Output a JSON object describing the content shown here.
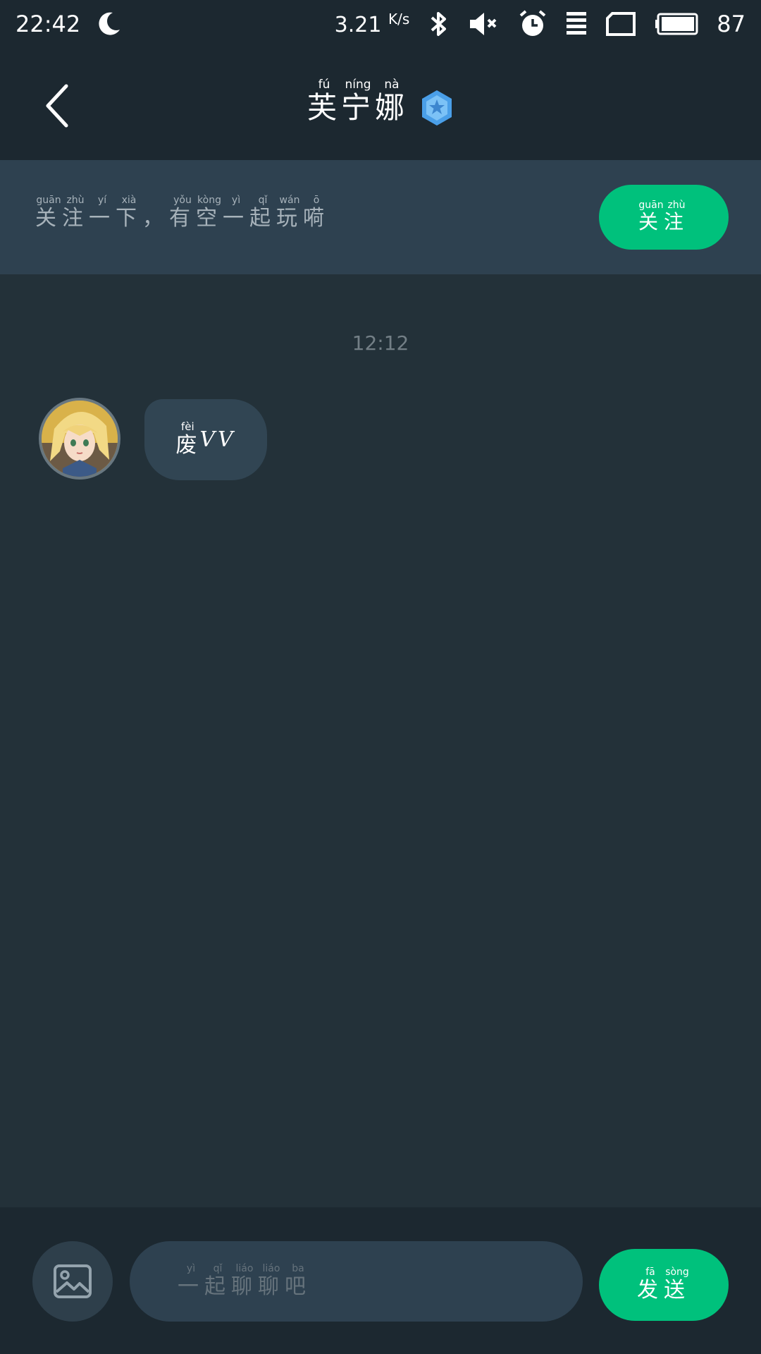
{
  "status_bar": {
    "time": "22:42",
    "net_speed": "3.21",
    "net_unit": "K/s",
    "battery": "87",
    "icons": [
      "moon-icon",
      "bluetooth-icon",
      "mute-icon",
      "alarm-icon",
      "signal-icon",
      "sim-icon",
      "battery-icon"
    ]
  },
  "header": {
    "back_icon": "chevron-left-icon",
    "title_chars": [
      {
        "c": "芙",
        "py": "fú"
      },
      {
        "c": "宁",
        "py": "níng"
      },
      {
        "c": "娜",
        "py": "nà"
      }
    ],
    "badge_icon": "verified-badge-icon"
  },
  "follow_banner": {
    "chars": [
      {
        "c": "关",
        "py": "guān"
      },
      {
        "c": "注",
        "py": "zhù"
      },
      {
        "c": "一",
        "py": "yí"
      },
      {
        "c": "下",
        "py": "xià"
      },
      {
        "c": "，",
        "py": ""
      },
      {
        "c": "有",
        "py": "yǒu"
      },
      {
        "c": "空",
        "py": "kòng"
      },
      {
        "c": "一",
        "py": "yì"
      },
      {
        "c": "起",
        "py": "qǐ"
      },
      {
        "c": "玩",
        "py": "wán"
      },
      {
        "c": "嗬",
        "py": "ō"
      }
    ],
    "button_chars": [
      {
        "c": "关",
        "py": "guān"
      },
      {
        "c": "注",
        "py": "zhù"
      }
    ]
  },
  "chat": {
    "timestamp": "12:12",
    "messages": [
      {
        "chars": [
          {
            "c": "废",
            "py": "fèi"
          }
        ],
        "suffix": "VV"
      }
    ]
  },
  "composer": {
    "image_icon": "image-icon",
    "placeholder_chars": [
      {
        "c": "一",
        "py": "yì"
      },
      {
        "c": "起",
        "py": "qǐ"
      },
      {
        "c": "聊",
        "py": "liáo"
      },
      {
        "c": "聊",
        "py": "liáo"
      },
      {
        "c": "吧",
        "py": "ba"
      }
    ],
    "send_chars": [
      {
        "c": "发",
        "py": "fā"
      },
      {
        "c": "送",
        "py": "sòng"
      }
    ]
  },
  "colors": {
    "accent": "#00c17c",
    "background": "#233139",
    "bar": "#1c2830",
    "banner": "#2e4150"
  }
}
